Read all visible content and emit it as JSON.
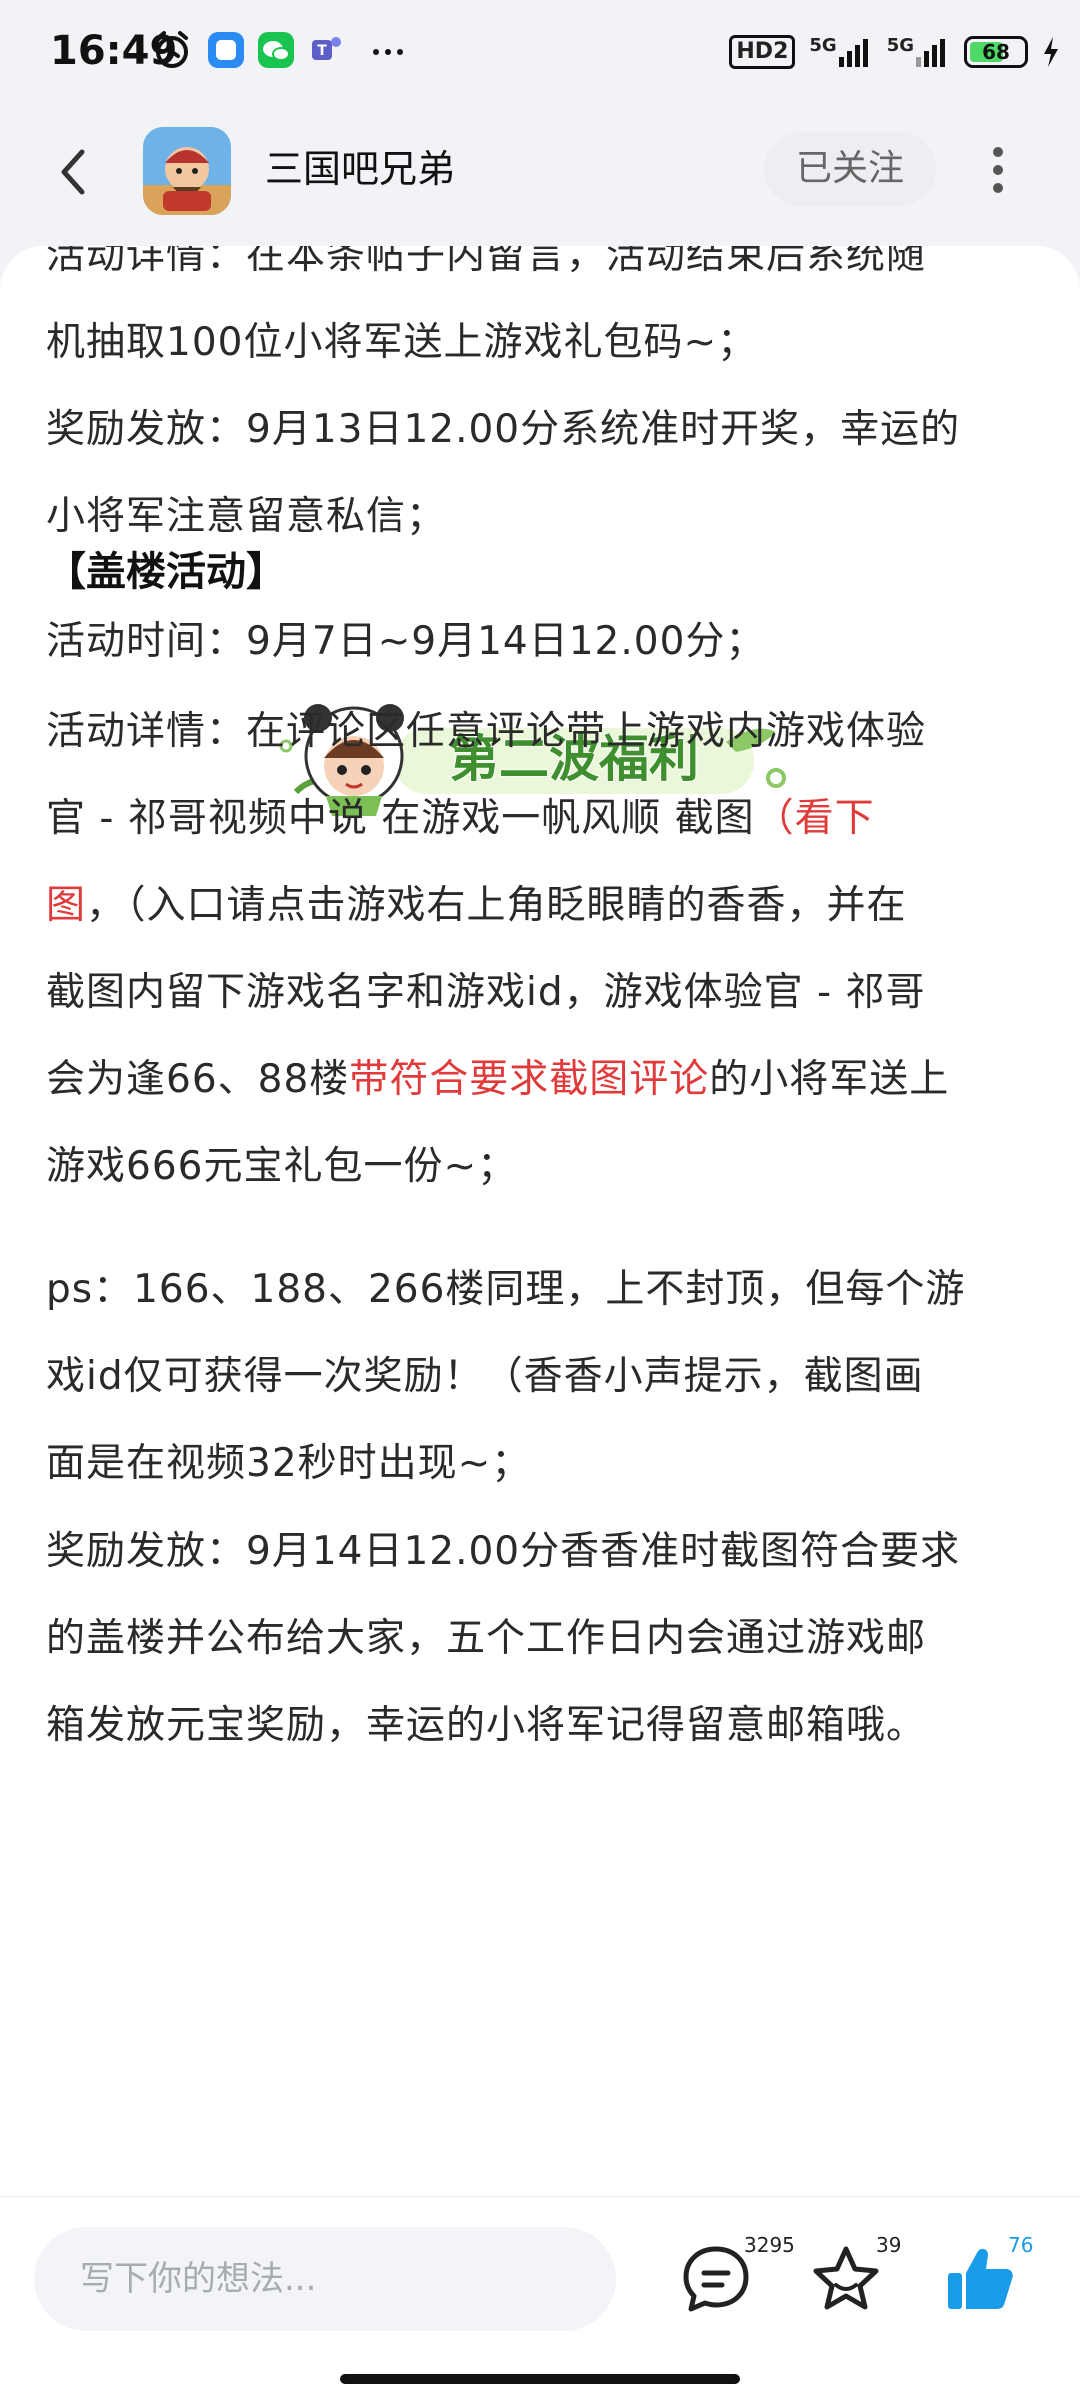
{
  "status": {
    "time": "16:49",
    "hd_label": "HD2",
    "network1": "5G",
    "network2": "5G",
    "battery": "68",
    "battery_fraction": 0.68
  },
  "header": {
    "title": "三国吧兄弟",
    "follow_label": "已关注"
  },
  "post": {
    "p1_a": "活动详情：在本条帖子内留言，活动结束后系统随",
    "p1_b": "机抽取100位小将军送上游戏礼包码~；",
    "p2_a": "奖励发放：9月13日12.00分系统准时开奖，幸运的",
    "p2_b": "小将军注意留意私信；",
    "banner_text": "第二波福利",
    "section_title": "【盖楼活动】",
    "p3": "活动时间：9月7日~9月14日12.00分；",
    "p4_l1": "活动详情：在评论区任意评论带上游戏内游戏体验",
    "p4_l2a": "官 - 祁哥视频中说 在游戏一帆风顺 截图",
    "p4_l2red": "（看下",
    "p4_l3red": "图",
    "p4_l3b": "，（入口请点击游戏右上角眨眼睛的香香，并在",
    "p4_l4": "截图内留下游戏名字和游戏id，游戏体验官 - 祁哥",
    "p4_l5a": "会为逢66、88楼",
    "p4_l5red": "带符合要求截图评论",
    "p4_l5b": "的小将军送上",
    "p4_l6": "游戏666元宝礼包一份~；",
    "p5_l1": "ps：166、188、266楼同理，上不封顶，但每个游",
    "p5_l2": "戏id仅可获得一次奖励！（香香小声提示，截图画",
    "p5_l3": "面是在视频32秒时出现~；",
    "p6_l1": "奖励发放：9月14日12.00分香香准时截图符合要求",
    "p6_l2": "的盖楼并公布给大家，五个工作日内会通过游戏邮",
    "p6_l3": "箱发放元宝奖励，幸运的小将军记得留意邮箱哦。"
  },
  "bottom": {
    "input_placeholder": "写下你的想法...",
    "comment_count": "3295",
    "favorite_count": "39",
    "like_count": "76"
  },
  "colors": {
    "accent_red": "#e03a3a",
    "like_blue": "#1a9be8",
    "banner_green": "#3f8f2e"
  }
}
